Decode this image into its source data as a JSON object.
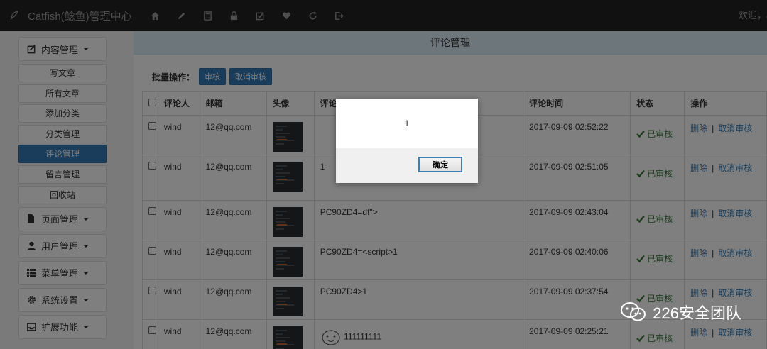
{
  "navbar": {
    "brand": "Catfish(鲶鱼)管理中心",
    "icons": [
      "home-icon",
      "pencil-icon",
      "list-icon",
      "lock-icon",
      "edit-icon",
      "heart-icon",
      "refresh-icon",
      "logout-icon"
    ],
    "welcome": "欢迎，a"
  },
  "sidebar": {
    "content_menu": "内容管理",
    "content_items": [
      "写文章",
      "所有文章",
      "添加分类",
      "分类管理",
      "评论管理",
      "留言管理",
      "回收站"
    ],
    "active_item": "评论管理",
    "other_menus": [
      "页面管理",
      "用户管理",
      "菜单管理",
      "系统设置",
      "扩展功能"
    ]
  },
  "main": {
    "page_title": "评论管理",
    "batch_label": "批量操作：",
    "approve_button": "审核",
    "unapprove_button": "取消审核"
  },
  "table": {
    "headers": [
      "评论人",
      "邮箱",
      "头像",
      "评论",
      "评论时间",
      "状态",
      "操作"
    ],
    "rows": [
      {
        "commenter": "wind",
        "email": "12@qq.com",
        "content": "",
        "time": "2017-09-09 02:52:22",
        "status": "已审核"
      },
      {
        "commenter": "wind",
        "email": "12@qq.com",
        "content": "1",
        "time": "2017-09-09 02:51:05",
        "status": "已审核"
      },
      {
        "commenter": "wind",
        "email": "12@qq.com",
        "content": "PC90ZD4=df\">",
        "time": "2017-09-09 02:43:04",
        "status": "已审核"
      },
      {
        "commenter": "wind",
        "email": "12@qq.com",
        "content": "PC90ZD4=<script>1",
        "time": "2017-09-09 02:40:06",
        "status": "已审核"
      },
      {
        "commenter": "wind",
        "email": "12@qq.com",
        "content": "PC90ZD4>1",
        "time": "2017-09-09 02:37:54",
        "status": "已审核"
      },
      {
        "commenter": "wind",
        "email": "12@qq.com",
        "content": "111111111",
        "time": "2017-09-09 02:25:21",
        "status": "已审核"
      }
    ],
    "delete_label": "删除",
    "op_separator": "|",
    "cancel_label": "取消审核"
  },
  "dialog": {
    "message": "1",
    "ok_label": "确定"
  },
  "watermark": "226安全团队"
}
